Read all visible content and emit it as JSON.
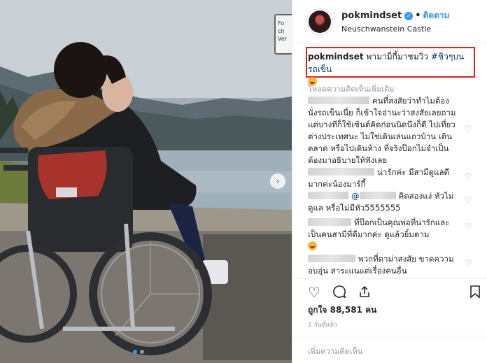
{
  "photo": {
    "sign_text": "Fo\nch\nVer",
    "next_icon": "chevron-right-icon",
    "carousel_dots": 2,
    "carousel_active_index": 0,
    "wheelchair_brand": "KARMA"
  },
  "header": {
    "username": "pokmindset",
    "verified": true,
    "separator": "•",
    "follow_label": "ติดตาม",
    "location": "Neuschwanstein Castle"
  },
  "caption": {
    "username": "pokmindset",
    "text": "พามาม็กี้มาชมวิว",
    "hashtag": "#ชิวๆบนรถเข็น",
    "highlight_color": "#e0201b"
  },
  "load_more": "โหลดความคิดเห็นเพิ่มเติม",
  "comments": [
    {
      "text": "คนที่สงสัยว่าทำไมต้องนั่งรถเข็นเนี่ย ก็เข้าใจอ่านะว่าสงสัยเลยถามแต่บางทีก็ใช้เซ้นต์คิดก่อนนิดนึงก็ดี ไปเที่ยวต่างประเทศนะ ไม่ใช่เดินเล่นแถวบ้าน เดินตลาด หรือไปเดินห้าง ที่จริงป๊อกไม่จำเป็นต้องมาอธิบายให้ฟังเลย"
    },
    {
      "text": "น่ารักค่ะ มีสามีดูแลดีมากค่ะน้องมาร์กี้"
    },
    {
      "mention": "@",
      "text": "คิดสองแง่ หัวไม่ดูแล หรือไม่มีหัว5555555"
    },
    {
      "text": "ที่ป๊อกเป็นคุณพ่อที่น่ารักและเป็นคนสามีที่ดีมากค่ะ ดูแล้วยิ้มตาม"
    },
    {
      "text": "พวกที่ดาม่าสงสัย ขาดความอบอุ่น สาระแนแต่เรื่องคนอื่น"
    }
  ],
  "actions": {
    "like_icon": "heart-icon",
    "comment_icon": "comment-icon",
    "share_icon": "share-icon",
    "save_icon": "bookmark-icon"
  },
  "likes": "ถูกใจ 88,581 คน",
  "timestamp": "1 วันที่แล้ว",
  "add_comment_placeholder": "เพิ่มความคิดเห็น"
}
